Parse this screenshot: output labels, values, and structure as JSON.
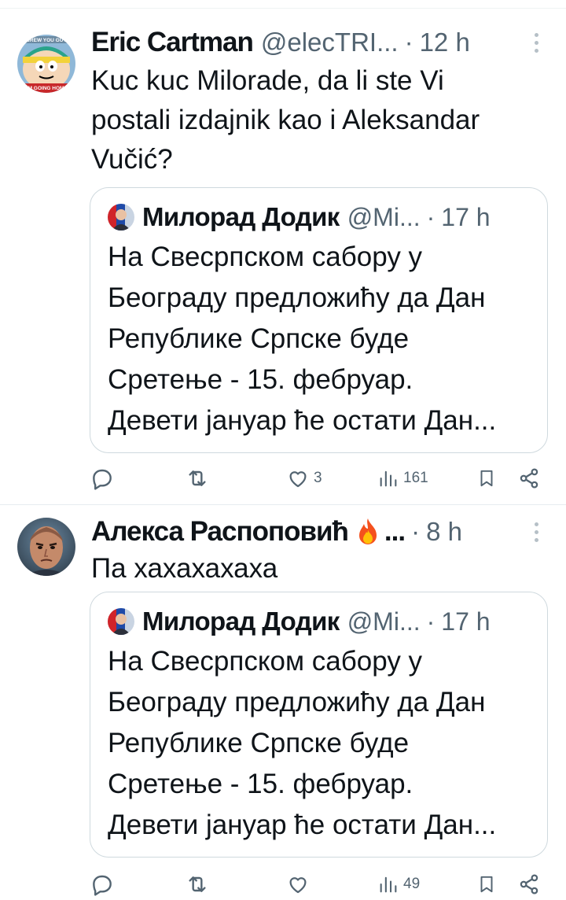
{
  "tweets": [
    {
      "author_name": "Eric Cartman",
      "handle": "@elecTRI...",
      "separator": "·",
      "time": "12 h",
      "avatar_banner_top": "SCREW YOU GUYS",
      "avatar_banner_bottom": "I'M GOING HOME",
      "text_lines": [
        "Kuc kuc Milorade, da li ste Vi",
        "postali izdajnik kao i Aleksandar",
        "Vučić?"
      ],
      "quote": {
        "author_name": "Милорад Додик",
        "handle": "@Mi...",
        "separator": "·",
        "time": "17 h",
        "text_lines": [
          "На Свесрпском сабору у",
          "Београду предложићу да Дан",
          "Републике Српске буде",
          "Сретење - 15. фебруар.",
          "Девети јануар ће остати Дан..."
        ]
      },
      "actions": {
        "reply": "",
        "retweet": "",
        "like": "3",
        "views": "161"
      }
    },
    {
      "author_name": "Алекса Распоповић",
      "name_suffix": "...",
      "handle": "",
      "separator": "·",
      "time": "8 h",
      "text_lines": [
        "Па хахахахаха"
      ],
      "quote": {
        "author_name": "Милорад Додик",
        "handle": "@Mi...",
        "separator": "·",
        "time": "17 h",
        "text_lines": [
          "На Свесрпском сабору у",
          "Београду предложићу да Дан",
          "Републике Српске буде",
          "Сретење - 15. фебруар.",
          "Девети јануар ће остати Дан..."
        ]
      },
      "actions": {
        "reply": "",
        "retweet": "",
        "like": "",
        "views": "49"
      }
    }
  ],
  "colors": {
    "text": "#0f1419",
    "muted": "#536471",
    "border": "#cfd9de",
    "divider": "#e6ecf0"
  },
  "icons": [
    "more-icon",
    "reply-icon",
    "retweet-icon",
    "like-icon",
    "views-icon",
    "bookmark-icon",
    "share-icon",
    "fire-emoji-icon"
  ]
}
